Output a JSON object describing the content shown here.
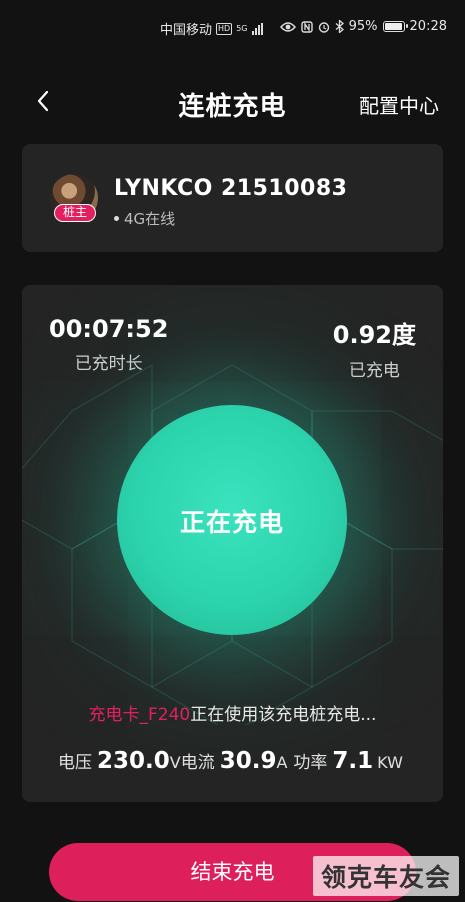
{
  "status_bar": {
    "carrier": "中国移动",
    "hd": "HD",
    "net": "5G",
    "battery": "95%",
    "time": "20:28"
  },
  "nav": {
    "title": "连桩充电",
    "config": "配置中心"
  },
  "device": {
    "badge": "桩主",
    "name": "LYNKCO  21510083",
    "status": "4G在线"
  },
  "charging": {
    "duration_value": "00:07:52",
    "duration_label": "已充时长",
    "energy_value": "0.92度",
    "energy_label": "已充电",
    "state": "正在充电",
    "card_name": "充电卡_F240",
    "card_msg": "正在使用该充电桩充电...",
    "voltage_label": "电压",
    "voltage_value": "230.0",
    "voltage_unit": "V",
    "current_label": "电流",
    "current_value": "30.9",
    "current_unit": "A",
    "power_label": "功率",
    "power_value": "7.1",
    "power_unit": "KW"
  },
  "actions": {
    "end_label": "结束充电"
  },
  "watermark": "领克车友会",
  "colors": {
    "accent": "#dd1f5c",
    "orb": "#2cd4ad",
    "card": "#242424",
    "background": "#121212"
  }
}
